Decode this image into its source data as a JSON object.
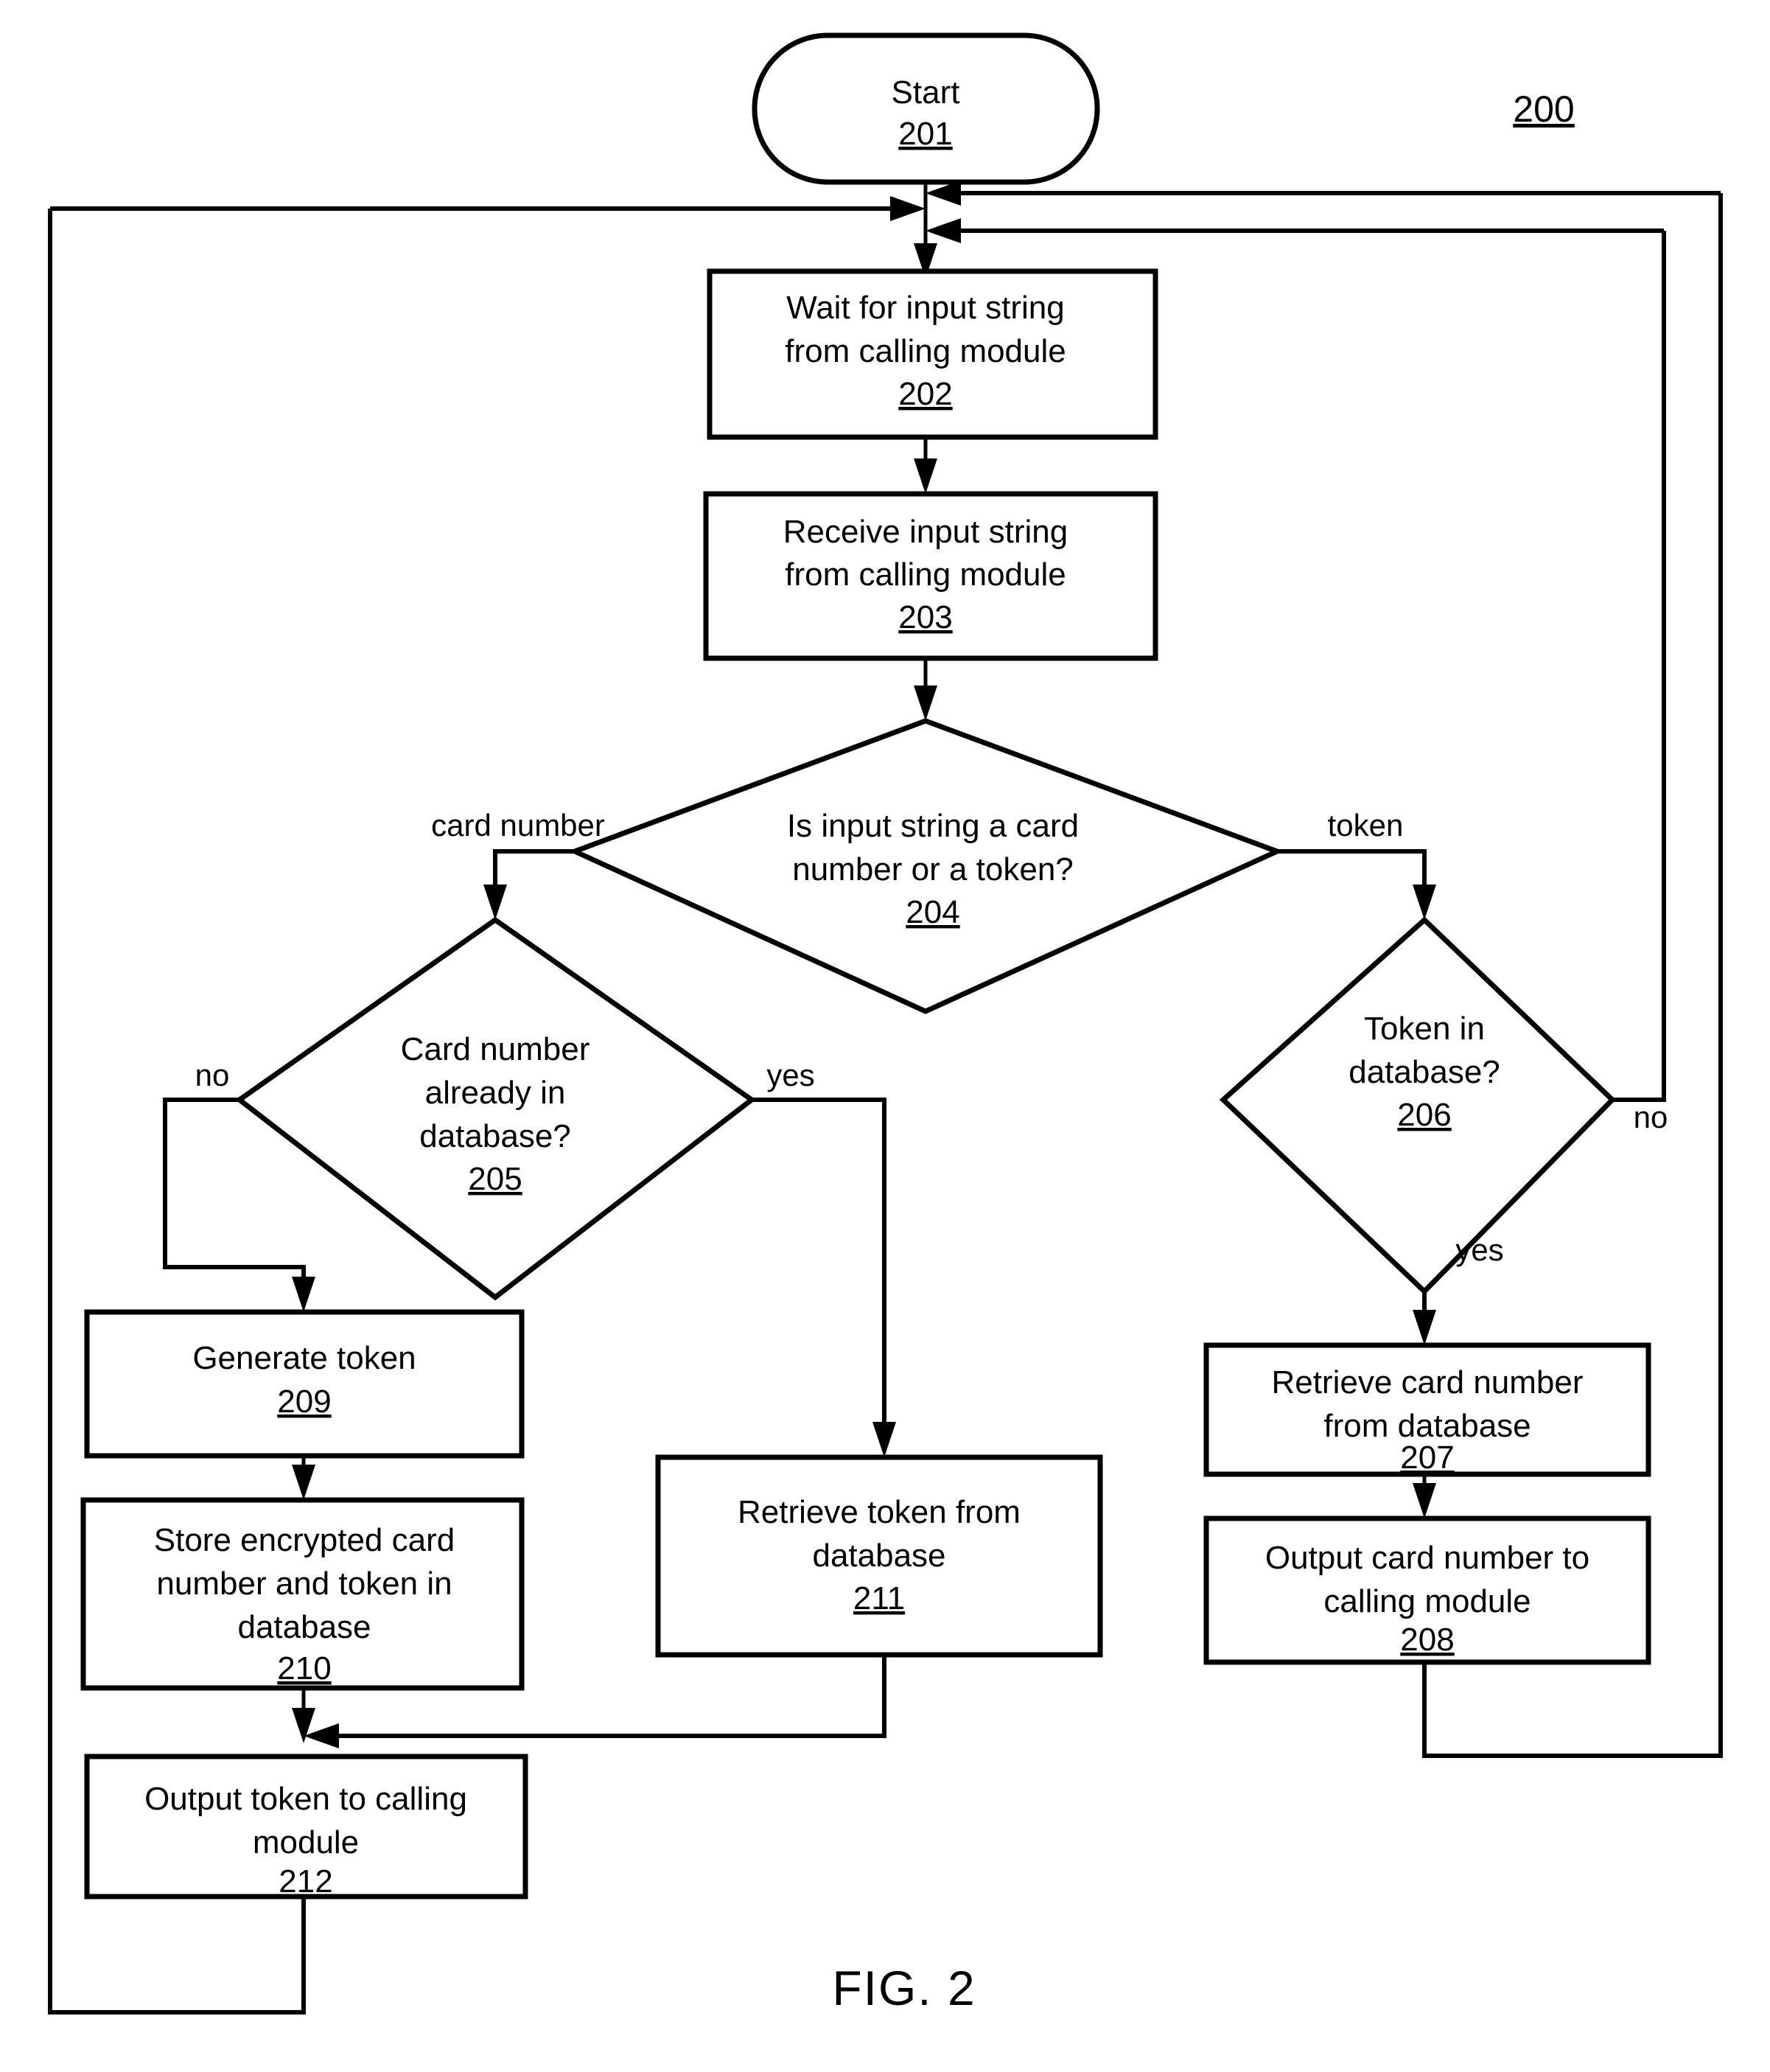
{
  "figure": {
    "caption": "FIG. 2",
    "reference_numeral": "200"
  },
  "nodes": {
    "start": {
      "id": "201",
      "shape": "terminator",
      "lines": [
        "Start"
      ]
    },
    "wait_input": {
      "id": "202",
      "shape": "process",
      "lines": [
        "Wait for input string",
        "from calling module"
      ]
    },
    "receive_input": {
      "id": "203",
      "shape": "process",
      "lines": [
        "Receive input string",
        "from calling module"
      ]
    },
    "classify_input": {
      "id": "204",
      "shape": "decision",
      "lines": [
        "Is input string a card",
        "number or a token?"
      ]
    },
    "card_in_db": {
      "id": "205",
      "shape": "decision",
      "lines": [
        "Card number",
        "already in",
        "database?"
      ]
    },
    "token_in_db": {
      "id": "206",
      "shape": "decision",
      "lines": [
        "Token in",
        "database?"
      ]
    },
    "retrieve_card": {
      "id": "207",
      "shape": "process",
      "lines": [
        "Retrieve card number",
        "from database"
      ]
    },
    "output_card": {
      "id": "208",
      "shape": "process",
      "lines": [
        "Output card number to",
        "calling module"
      ]
    },
    "generate_token": {
      "id": "209",
      "shape": "process",
      "lines": [
        "Generate token"
      ]
    },
    "store_encrypted": {
      "id": "210",
      "shape": "process",
      "lines": [
        "Store encrypted card",
        "number and token in",
        "database"
      ]
    },
    "retrieve_token": {
      "id": "211",
      "shape": "process",
      "lines": [
        "Retrieve token from",
        "database"
      ]
    },
    "output_token": {
      "id": "212",
      "shape": "process",
      "lines": [
        "Output  token to calling",
        "module"
      ]
    }
  },
  "edge_labels": {
    "card_number": "card number",
    "token": "token",
    "no_205": "no",
    "yes_205": "yes",
    "no_206": "no",
    "yes_206": "yes"
  },
  "colors": {
    "stroke": "#000000",
    "fill": "#ffffff"
  }
}
